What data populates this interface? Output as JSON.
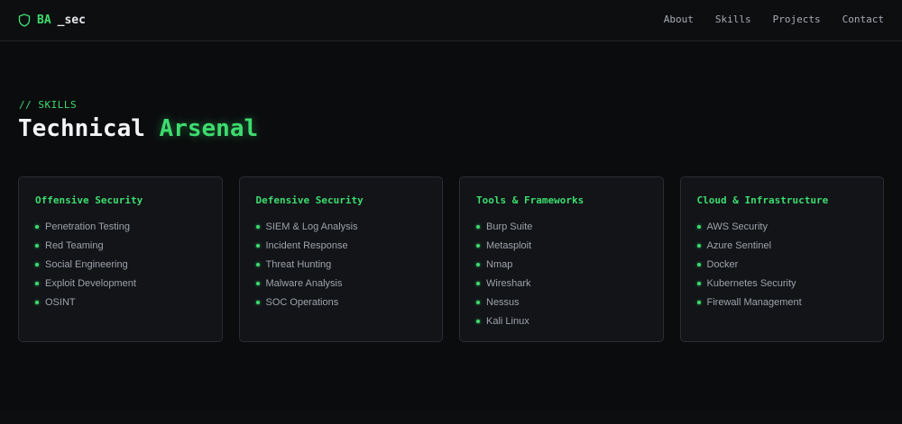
{
  "brand": {
    "accent": "BA",
    "rest": "_sec",
    "icon": "shield-icon"
  },
  "nav": [
    "About",
    "Skills",
    "Projects",
    "Contact"
  ],
  "section": {
    "tag": "// SKILLS",
    "title_main": "Technical",
    "title_highlight": "Arsenal"
  },
  "cards": [
    {
      "title": "Offensive Security",
      "items": [
        "Penetration Testing",
        "Red Teaming",
        "Social Engineering",
        "Exploit Development",
        "OSINT"
      ]
    },
    {
      "title": "Defensive Security",
      "items": [
        "SIEM & Log Analysis",
        "Incident Response",
        "Threat Hunting",
        "Malware Analysis",
        "SOC Operations"
      ]
    },
    {
      "title": "Tools & Frameworks",
      "items": [
        "Burp Suite",
        "Metasploit",
        "Nmap",
        "Wireshark",
        "Nessus",
        "Kali Linux"
      ]
    },
    {
      "title": "Cloud & Infrastructure",
      "items": [
        "AWS Security",
        "Azure Sentinel",
        "Docker",
        "Kubernetes Security",
        "Firewall Management"
      ]
    }
  ],
  "colors": {
    "accent": "#3ddc6f",
    "background": "#0b0c0e",
    "card": "#121418",
    "border": "#2a2d33"
  }
}
